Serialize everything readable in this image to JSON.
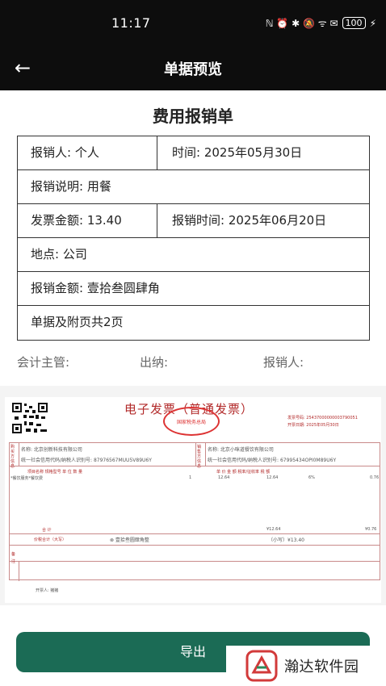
{
  "status_bar": {
    "time": "11:17",
    "icons": "ℕ ⏰ ✱ 🔕 ᯤ ✉",
    "battery": "100"
  },
  "header": {
    "back_icon": "←",
    "title": "单据预览"
  },
  "form": {
    "title": "费用报销单",
    "rows": [
      {
        "left": "报销人: 个人",
        "right": "时间: 2025年05月30日"
      },
      {
        "full": "报销说明: 用餐"
      },
      {
        "left": "发票金额: 13.40",
        "right": "报销时间: 2025年06月20日"
      },
      {
        "full": "地点: 公司"
      },
      {
        "full": "报销金额: 壹拾叁圆肆角"
      },
      {
        "full": "单据及附页共2页"
      }
    ],
    "signatures": {
      "accounting": "会计主管:",
      "cashier": "出纳:",
      "claimant": "报销人:"
    }
  },
  "invoice": {
    "title": "电子发票（普通发票）",
    "seal_text": "国家税务总局",
    "invoice_no_label": "发票号码: 25437000000003790051",
    "issue_date_label": "开票日期: 2025年05月30日",
    "buyer_name": "名称: 北京创新科技有限公司",
    "buyer_tax": "统一社会信用代码/纳税人识别号: 87976567MUU5V89U6Y",
    "seller_name": "名称: 北京小咪道餐饮有限公司",
    "seller_tax": "统一社会信用代码/纳税人识别号: 67995434OPI0M89U6Y",
    "col_headers": "项目名称      规格型号      单 位      数 量",
    "col_headers_right": "单 价        金 额      税率/征收率      税 额",
    "item_name": "*餐饮服务*餐饮费",
    "item_qty": "1",
    "item_price": "12.64",
    "item_amount": "12.64",
    "item_rate": "6%",
    "item_tax": "0.76",
    "total_label": "合    计",
    "total_amount": "¥12.64",
    "total_tax": "¥0.76",
    "grand_total_label": "价税合计（大写）",
    "grand_total_words": "⊗ 壹拾叁圆肆角整",
    "grand_total_small": "（小写）¥13.40",
    "remark_label": "备注",
    "issuer": "开票人: 猪猪",
    "buyer_label": "购买方信息",
    "seller_label": "销售方信息"
  },
  "export_button": {
    "label": "导出"
  },
  "watermark": {
    "text": "瀚达软件园"
  },
  "colors": {
    "accent": "#1b6b55",
    "invoice_red": "#b22a2a",
    "dark_bar": "#0d0d0d"
  }
}
